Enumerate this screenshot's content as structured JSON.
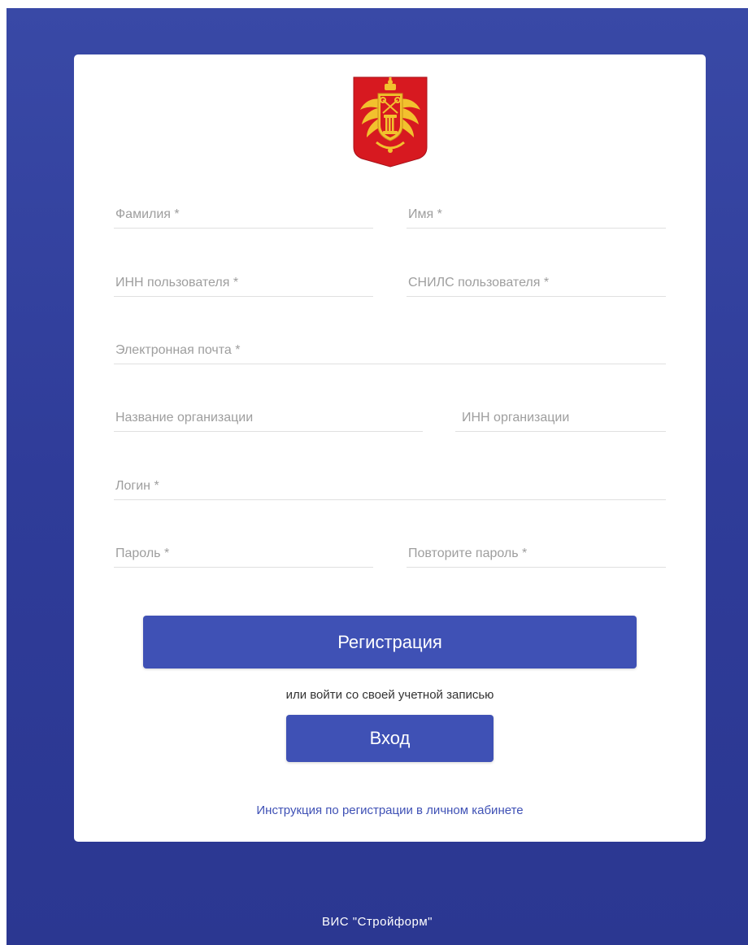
{
  "form": {
    "last_name_placeholder": "Фамилия *",
    "first_name_placeholder": "Имя *",
    "user_inn_placeholder": "ИНН пользователя *",
    "snils_placeholder": "СНИЛС пользователя *",
    "email_placeholder": "Электронная почта *",
    "org_name_placeholder": "Название организации",
    "org_inn_placeholder": "ИНН организации",
    "login_placeholder": "Логин *",
    "password_placeholder": "Пароль *",
    "password_repeat_placeholder": "Повторите пароль *"
  },
  "actions": {
    "register_label": "Регистрация",
    "or_text": "или войти со своей учетной записью",
    "login_label": "Вход",
    "instruction_link": "Инструкция по регистрации в личном кабинете"
  },
  "footer": {
    "text": "ВИС \"Стройформ\""
  },
  "colors": {
    "background": "#3949a6",
    "accent": "#3f51b5",
    "emblem_red": "#d71920",
    "emblem_gold": "#f2c12e"
  },
  "icons": {
    "emblem": "coat-of-arms-icon"
  }
}
